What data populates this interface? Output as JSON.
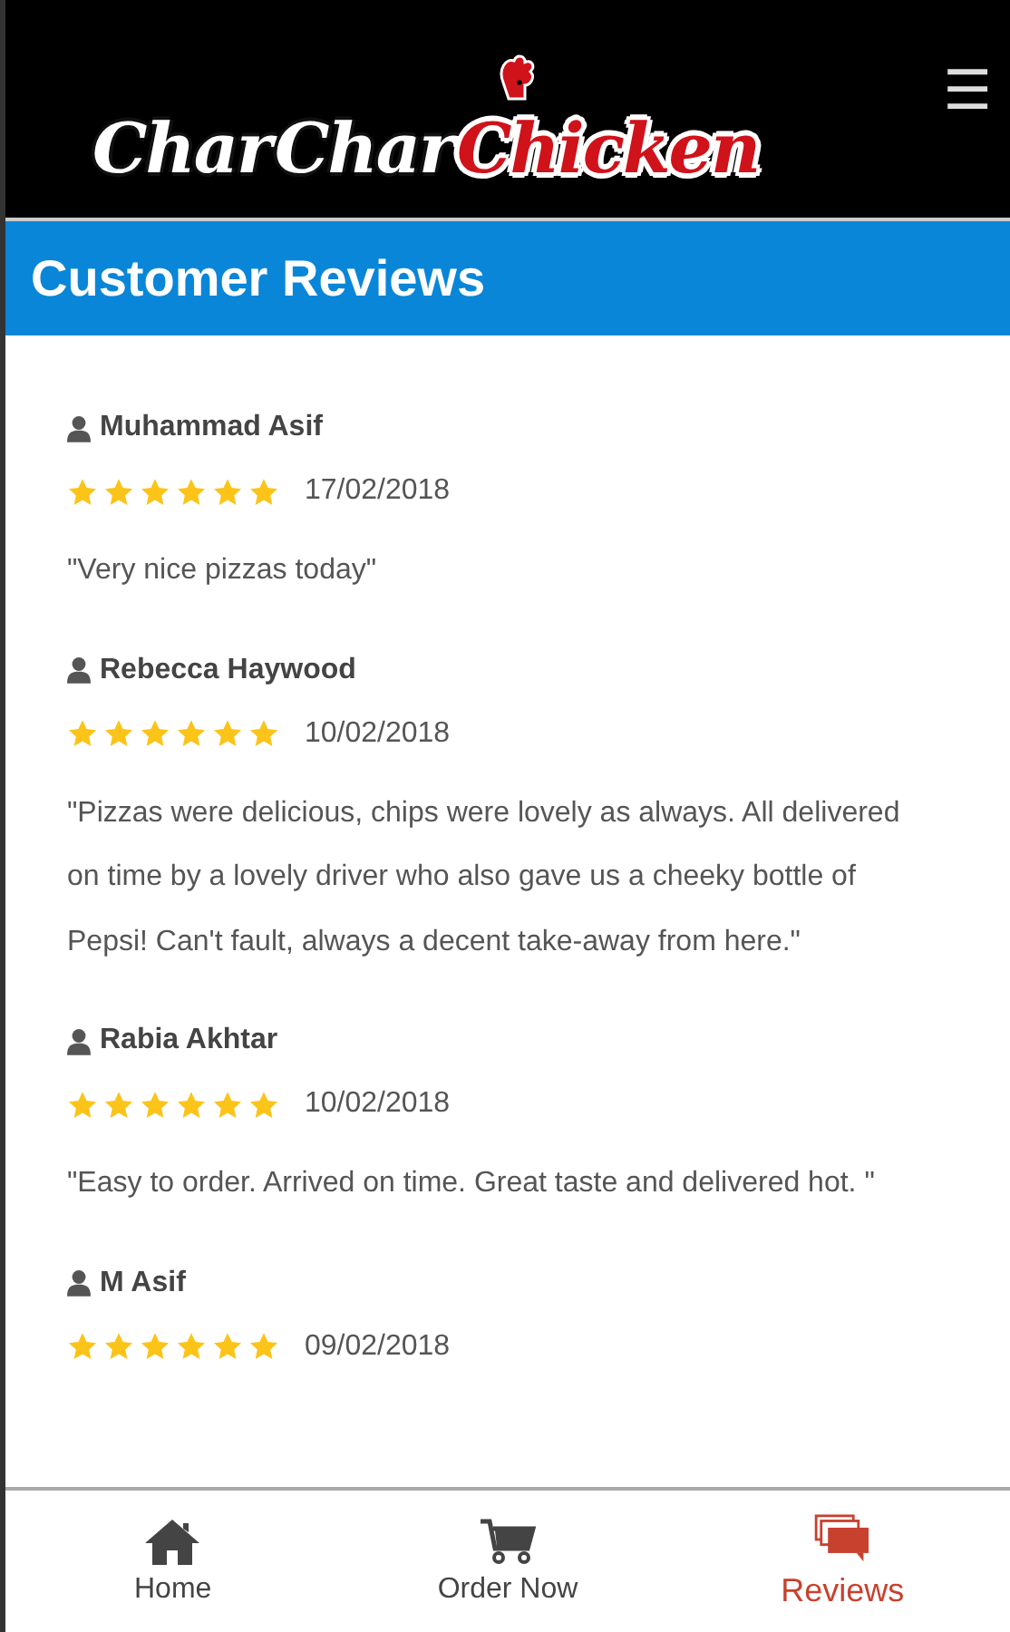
{
  "header": {
    "logo": {
      "word_1": "Char",
      "word_2": "Char",
      "word_3": "Chicken"
    },
    "menu_icon": "☰"
  },
  "title": "Customer Reviews",
  "reviews": [
    {
      "name": "Muhammad Asif",
      "stars": 6,
      "date": "17/02/2018",
      "text": "\"Very nice pizzas today\""
    },
    {
      "name": "Rebecca Haywood",
      "stars": 6,
      "date": "10/02/2018",
      "text": "\"Pizzas were delicious, chips were lovely as always. All delivered on time by a lovely driver who also gave us a cheeky bottle of Pepsi! Can't fault, always a decent take-away from here.\""
    },
    {
      "name": "Rabia Akhtar",
      "stars": 6,
      "date": "10/02/2018",
      "text": "\"Easy to order. Arrived on time. Great taste and delivered hot. \""
    },
    {
      "name": "M Asif",
      "stars": 6,
      "date": "09/02/2018"
    }
  ],
  "nav": [
    {
      "kind": "home",
      "label": "Home",
      "selected": false
    },
    {
      "kind": "cart",
      "label": "Order Now",
      "selected": false
    },
    {
      "kind": "reviews",
      "label": "Reviews",
      "selected": true
    }
  ]
}
